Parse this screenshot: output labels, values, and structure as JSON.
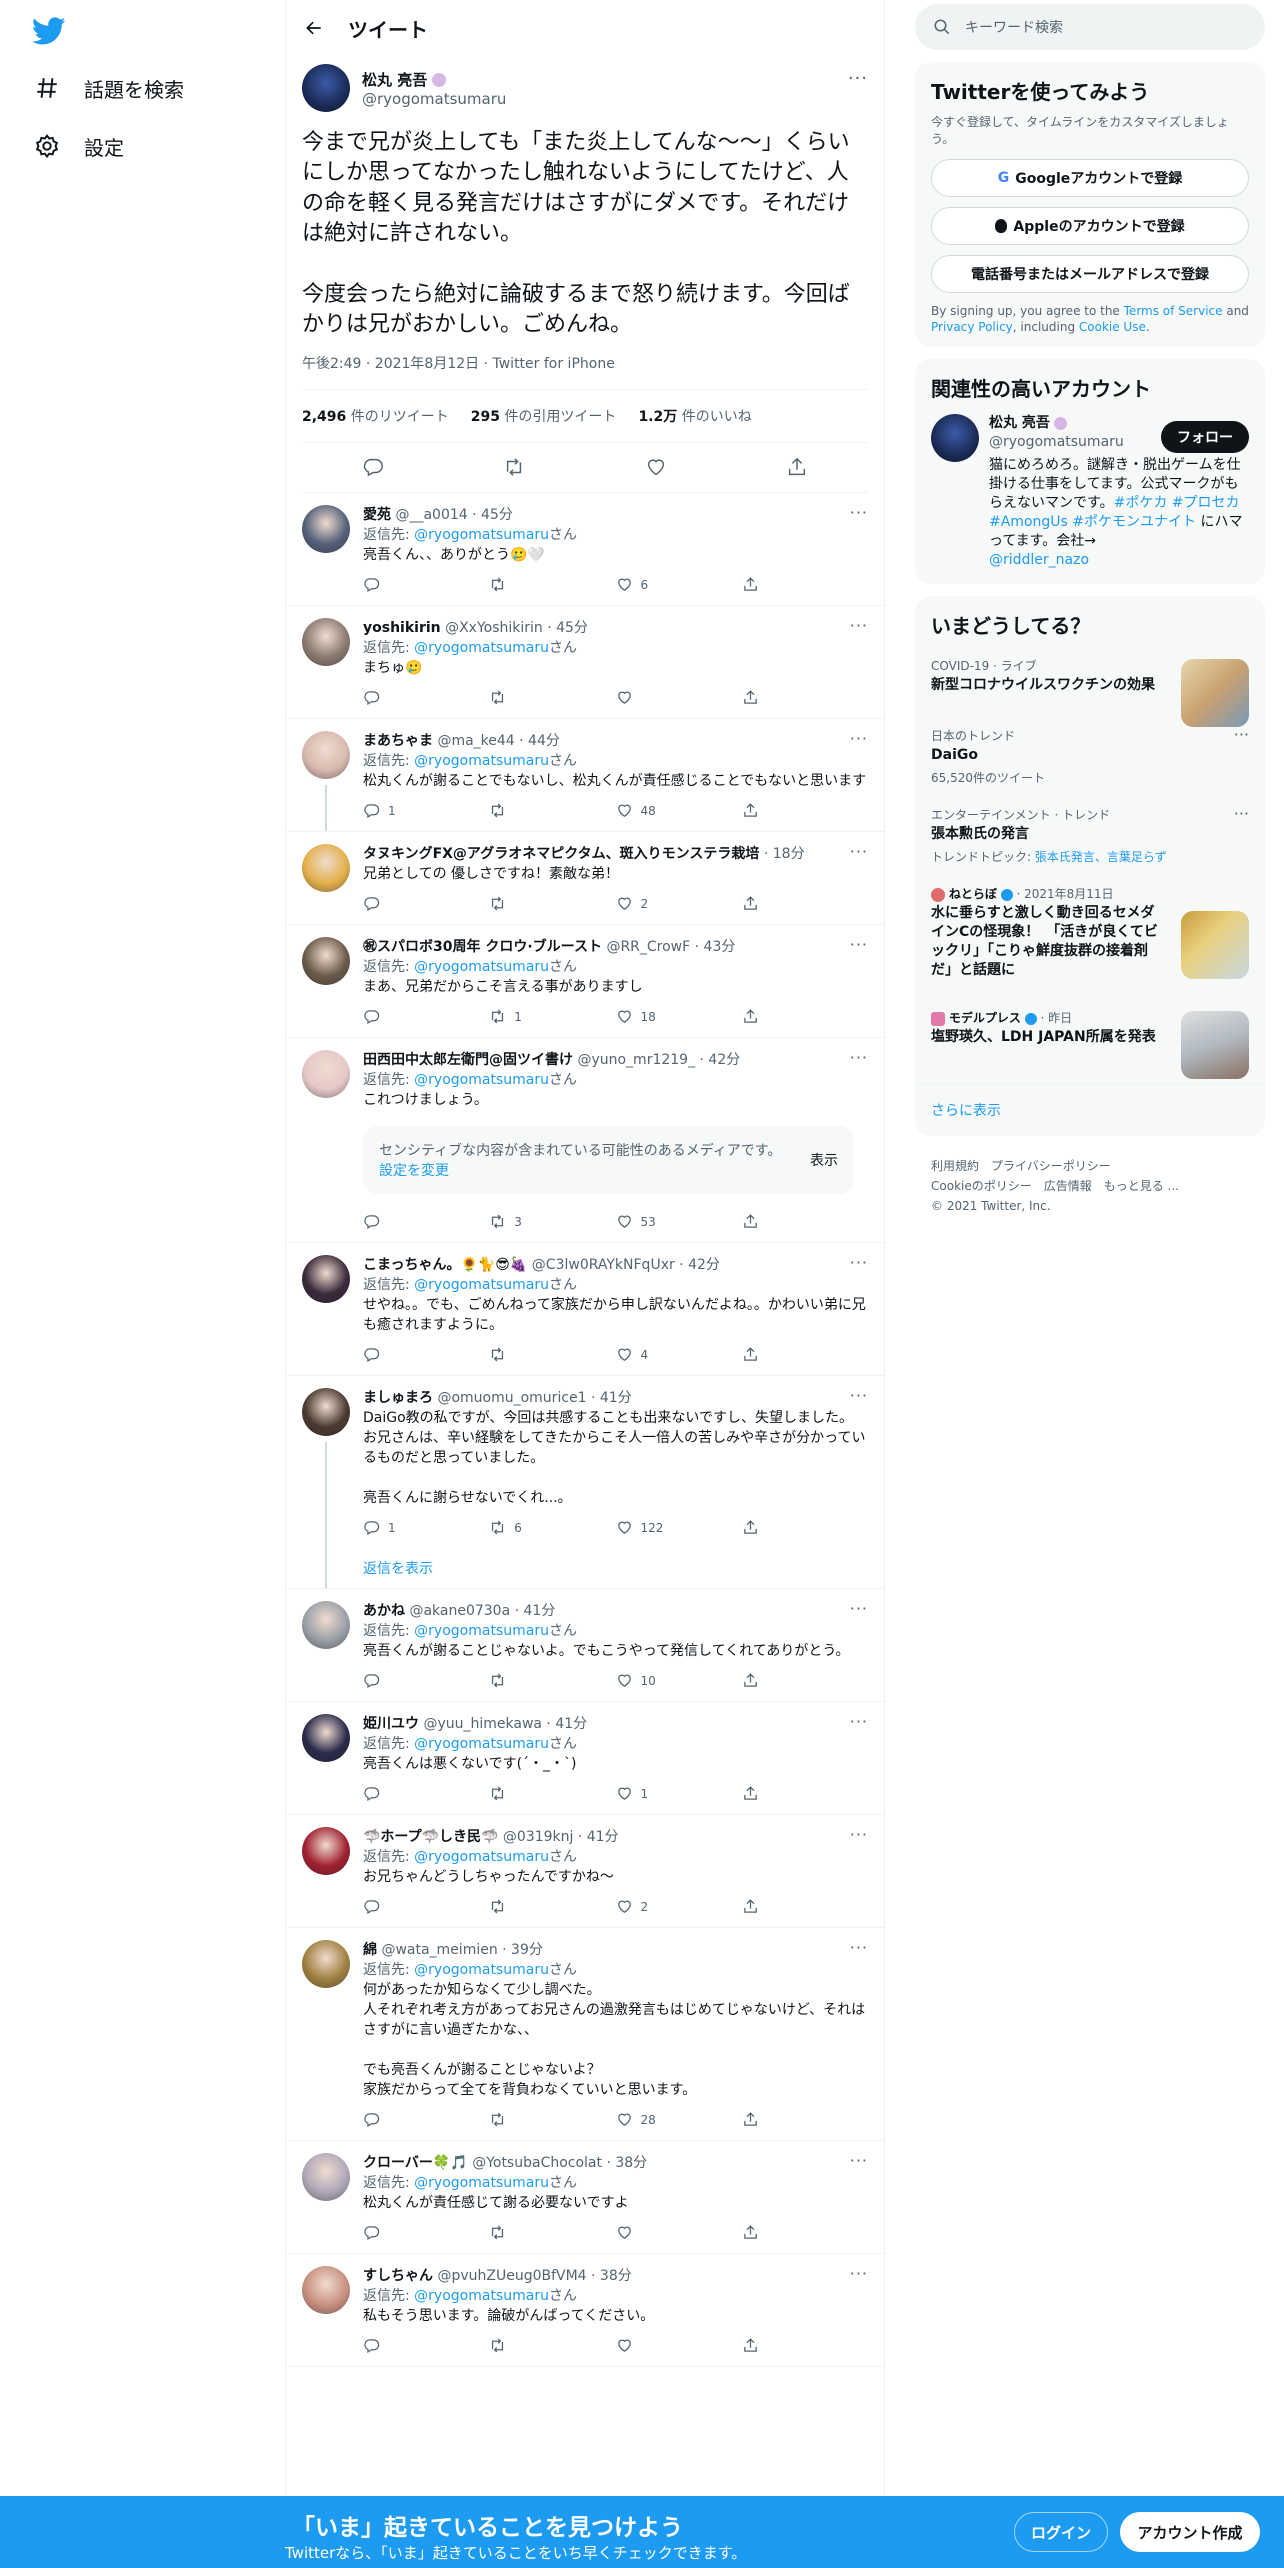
{
  "nav": {
    "explore": "話題を検索",
    "settings": "設定"
  },
  "header": {
    "title": "ツイート"
  },
  "tweet": {
    "name": "松丸 亮吾",
    "handle": "@ryogomatsumaru",
    "text": "今まで兄が炎上しても「また炎上してんな〜〜」くらいにしか思ってなかったし触れないようにしてたけど、人の命を軽く見る発言だけはさすがにダメです。それだけは絶対に許されない。\n\n今度会ったら絶対に論破するまで怒り続けます。今回ばかりは兄がおかしい。ごめんね。",
    "time": "午後2:49 · 2021年8月12日 · Twitter for iPhone",
    "retweets": "2,496",
    "retweets_label": "件のリツイート",
    "quotes": "295",
    "quotes_label": "件の引用ツイート",
    "likes": "1.2万",
    "likes_label": "件のいいね"
  },
  "replies": [
    {
      "name": "愛苑",
      "handle": "@__a0014 · 45分",
      "to": "@ryogomatsumaru",
      "san": "さん",
      "text": "亮吾くん、、ありがとう🥲🤍",
      "reply": "",
      "rt": "",
      "like": "6",
      "color": "#54607a"
    },
    {
      "name": "yoshikirin",
      "handle": "@XxYoshikirin · 45分",
      "to": "@ryogomatsumaru",
      "san": "さん",
      "text": "まちゅ🥲",
      "reply": "",
      "rt": "",
      "like": "",
      "color": "#8a7a70"
    },
    {
      "name": "まあちゃま",
      "handle": "@ma_ke44 · 44分",
      "to": "@ryogomatsumaru",
      "san": "さん",
      "text": "松丸くんが謝ることでもないし、松丸くんが責任感じることでもないと思います",
      "reply": "1",
      "rt": "",
      "like": "48",
      "color": "#d8b9b0"
    },
    {
      "name": "タヌキングFX@アグラオネマピクタム、斑入りモンステラ栽培",
      "handle": "· 18分",
      "to": "",
      "san": "",
      "text": "兄弟としての 優しさですね！素敵な弟！",
      "reply": "",
      "rt": "",
      "like": "2",
      "color": "#e3b04b"
    },
    {
      "name": "㊗スパロボ30周年 クロウ·ブルースト",
      "handle": "@RR_CrowF · 43分",
      "to": "@ryogomatsumaru",
      "san": "さん",
      "text": "まあ、兄弟だからこそ言える事がありますし",
      "reply": "",
      "rt": "1",
      "like": "18",
      "color": "#6a5a4a"
    },
    {
      "name": "田西田中太郎左衛門@固ツイ書け",
      "handle": "@yuno_mr1219_ · 42分",
      "to": "@ryogomatsumaru",
      "san": "さん",
      "text": "これつけましょう。",
      "reply": "",
      "rt": "3",
      "like": "53",
      "color": "#e6c8c8",
      "sensitive": "センシティブな内容が含まれている可能性のあるメディアです。",
      "sensitive_link": "設定を変更",
      "sensitive_show": "表示"
    },
    {
      "name": "こまっちゃん。🌻🐈😎🍇",
      "handle": "@C3lw0RAYkNFqUxr · 42分",
      "to": "@ryogomatsumaru",
      "san": "さん",
      "text": "せやね。。でも、ごめんねって家族だから申し訳ないんだよね。。かわいい弟に兄も癒されますように。",
      "reply": "",
      "rt": "",
      "like": "4",
      "color": "#3a2a3a"
    },
    {
      "name": "ましゅまろ",
      "handle": "@omuomu_omurice1 · 41分",
      "to": "",
      "san": "",
      "text": "DaiGo教の私ですが、今回は共感することも出来ないですし、失望しました。\nお兄さんは、辛い経験をしてきたからこそ人一倍人の苦しみや辛さが分かっているものだと思っていました。\n\n亮吾くんに謝らせないでくれ...。",
      "reply": "1",
      "rt": "6",
      "like": "122",
      "color": "#4a3a30",
      "showrep": "返信を表示"
    },
    {
      "name": "あかね",
      "handle": "@akane0730a · 41分",
      "to": "@ryogomatsumaru",
      "san": "さん",
      "text": "亮吾くんが謝ることじゃないよ。でもこうやって発信してくれてありがとう。",
      "reply": "",
      "rt": "",
      "like": "10",
      "color": "#9aa0a8"
    },
    {
      "name": "姫川ユウ",
      "handle": "@yuu_himekawa · 41分",
      "to": "@ryogomatsumaru",
      "san": "さん",
      "text": "亮吾くんは悪くないです(´・_・`)",
      "reply": "",
      "rt": "",
      "like": "1",
      "color": "#2a2a4a"
    },
    {
      "name": "🦈ホープ🦈しき民🦈",
      "handle": "@0319knj · 41分",
      "to": "@ryogomatsumaru",
      "san": "さん",
      "text": "お兄ちゃんどうしちゃったんですかね〜",
      "reply": "",
      "rt": "",
      "like": "2",
      "color": "#a02030"
    },
    {
      "name": "綿",
      "handle": "@wata_meimien · 39分",
      "to": "@ryogomatsumaru",
      "san": "さん",
      "text": "何があったか知らなくて少し調べた。\n人それぞれ考え方があってお兄さんの過激発言もはじめてじゃないけど、それはさすがに言い過ぎたかな、、\n\nでも亮吾くんが謝ることじゃないよ？\n家族だからって全てを背負わなくていいと思います。",
      "reply": "",
      "rt": "",
      "like": "28",
      "color": "#a08040"
    },
    {
      "name": "クローバー🍀🎵",
      "handle": "@YotsubaChocolat · 38分",
      "to": "@ryogomatsumaru",
      "san": "さん",
      "text": "松丸くんが責任感じて謝る必要ないですよ",
      "reply": "",
      "rt": "",
      "like": "",
      "color": "#b0a8b8"
    },
    {
      "name": "すしちゃん",
      "handle": "@pvuhZUeug0BfVM4 · 38分",
      "to": "@ryogomatsumaru",
      "san": "さん",
      "text": "私もそう思います。論破がんばってください。",
      "reply": "",
      "rt": "",
      "like": "",
      "color": "#c89080"
    }
  ],
  "reply_to_label": "返信先: ",
  "sidebar": {
    "search_placeholder": "キーワード検索",
    "signup": {
      "title": "Twitterを使ってみよう",
      "desc": "今すぐ登録して、タイムラインをカスタマイズしましょう。",
      "google": "Googleアカウントで登録",
      "apple": "Appleのアカウントで登録",
      "phone": "電話番号またはメールアドレスで登録",
      "terms_pre": "By signing up, you agree to the ",
      "terms": "Terms of Service",
      "and": " and ",
      "privacy": "Privacy Policy",
      "including": ", including ",
      "cookie": "Cookie Use",
      "dot": "."
    },
    "related": {
      "title": "関連性の高いアカウント",
      "name": "松丸 亮吾",
      "handle": "@ryogomatsumaru",
      "follow": "フォロー",
      "bio": "猫にめろめろ。謎解き・脱出ゲームを仕掛ける仕事をしてます。公式マークがもらえないマンです。",
      "tags": "#ポケカ #プロセカ #AmongUs #ポケモンユナイト",
      "bio2": "にハマってます。会社→",
      "link": "@riddler_nazo"
    },
    "trends": {
      "title": "いまどうしてる？",
      "items": [
        {
          "cat": "COVID-19 · ライブ",
          "title": "新型コロナウイルスワクチンの効果",
          "sub": ""
        },
        {
          "cat": "日本のトレンド",
          "title": "DaiGo",
          "sub": "65,520件のツイート"
        },
        {
          "cat": "エンターテインメント · トレンド",
          "title": "張本勲氏の発言",
          "sub_pre": "トレンドトピック: ",
          "sub_link": "張本氏発言、言葉足らず"
        },
        {
          "cat": "ねとらぼ",
          "cat2": " · 2021年8月11日",
          "title": "水に垂らすと激しく動き回るセメダインCの怪現象！　「活きが良くてビックリ」「こりゃ鮮度抜群の接着剤だ」と話題に"
        },
        {
          "cat": "モデルプレス",
          "cat2": " · 昨日",
          "title": "塩野瑛久、LDH JAPAN所属を発表"
        }
      ],
      "more": "さらに表示"
    },
    "footer": {
      "l1": "利用規約　プライバシーポリシー",
      "l2": "Cookieのポリシー　広告情報　もっと見る ...",
      "l3": "© 2021 Twitter, Inc."
    }
  },
  "banner": {
    "title": "「いま」起きていることを見つけよう",
    "sub": "Twitterなら、「いま」起きていることをいち早くチェックできます。",
    "login": "ログイン",
    "signup": "アカウント作成"
  }
}
